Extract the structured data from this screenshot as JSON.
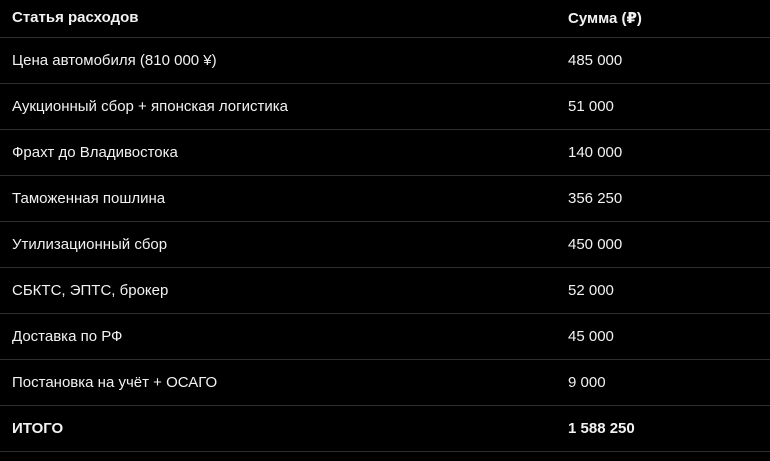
{
  "table": {
    "headers": {
      "item": "Статья расходов",
      "amount": "Сумма (₽)"
    },
    "rows": [
      {
        "item": "Цена автомобиля (810 000 ¥)",
        "amount": "485 000"
      },
      {
        "item": "Аукционный сбор + японская логистика",
        "amount": "51 000"
      },
      {
        "item": "Фрахт до Владивостока",
        "amount": "140 000"
      },
      {
        "item": "Таможенная пошлина",
        "amount": "356 250"
      },
      {
        "item": "Утилизационный сбор",
        "amount": "450 000"
      },
      {
        "item": "СБКТС, ЭПТС, брокер",
        "amount": "52 000"
      },
      {
        "item": "Доставка по РФ",
        "amount": "45 000"
      },
      {
        "item": "Постановка на учёт + ОСАГО",
        "amount": "9 000"
      }
    ],
    "total": {
      "item": "ИТОГО",
      "amount": "1 588 250"
    }
  },
  "colors": {
    "background": "#000000",
    "text": "#f2f2f2",
    "divider": "#2e2e2e"
  }
}
